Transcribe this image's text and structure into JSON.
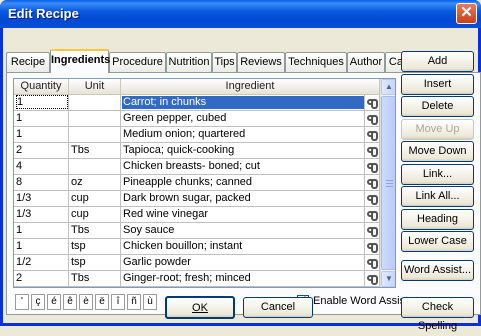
{
  "window": {
    "title": "Edit Recipe",
    "close_glyph": "✕"
  },
  "tabs": [
    "Recipe",
    "Ingredients",
    "Procedure",
    "Nutrition",
    "Tips",
    "Reviews",
    "Techniques",
    "Author",
    "Capture"
  ],
  "active_tab": "Ingredients",
  "grid": {
    "headers": [
      "Quantity",
      "Unit",
      "Ingredient"
    ],
    "rows": [
      {
        "quantity": "1",
        "unit": "",
        "ingredient": "Carrot; in chunks",
        "selected": true
      },
      {
        "quantity": "1",
        "unit": "",
        "ingredient": "Green pepper, cubed"
      },
      {
        "quantity": "1",
        "unit": "",
        "ingredient": "Medium onion; quartered"
      },
      {
        "quantity": "2",
        "unit": "Tbs",
        "ingredient": "Tapioca; quick-cooking"
      },
      {
        "quantity": "4",
        "unit": "",
        "ingredient": "Chicken breasts- boned; cut"
      },
      {
        "quantity": "8",
        "unit": "oz",
        "ingredient": "Pineapple chunks; canned"
      },
      {
        "quantity": "1/3",
        "unit": "cup",
        "ingredient": "Dark brown sugar, packed"
      },
      {
        "quantity": "1/3",
        "unit": "cup",
        "ingredient": "Red wine vinegar"
      },
      {
        "quantity": "1",
        "unit": "Tbs",
        "ingredient": "Soy sauce"
      },
      {
        "quantity": "1",
        "unit": "tsp",
        "ingredient": "Chicken bouillon; instant"
      },
      {
        "quantity": "1/2",
        "unit": "tsp",
        "ingredient": "Garlic powder"
      },
      {
        "quantity": "2",
        "unit": "Tbs",
        "ingredient": "Ginger-root; fresh; minced"
      }
    ],
    "link_icon": "chain-link-icon",
    "scroll_up": "▲",
    "scroll_down": "▼"
  },
  "side_buttons": [
    {
      "label": "Add",
      "enabled": true
    },
    {
      "label": "Insert",
      "enabled": true
    },
    {
      "label": "Delete",
      "enabled": true
    },
    {
      "label": "Move Up",
      "enabled": false
    },
    {
      "label": "Move Down",
      "enabled": true
    },
    {
      "label": "Link...",
      "enabled": true
    },
    {
      "label": "Link All...",
      "enabled": true
    },
    {
      "label": "Heading",
      "enabled": true
    },
    {
      "label": "Lower Case",
      "enabled": true
    }
  ],
  "accents": [
    "'",
    "ç",
    "é",
    "ê",
    "è",
    "ë",
    "î",
    "ñ",
    "ù"
  ],
  "word_assist": {
    "checkbox_label": "Enable Word Assist",
    "checked": true,
    "check_glyph": "✓",
    "button_label": "Word Assist..."
  },
  "footer": {
    "ok_label": "OK",
    "cancel_label": "Cancel",
    "spell_label": "Check Spelling"
  },
  "colors": {
    "selection": "#316ac5",
    "titlebar": "#0a59e0",
    "active_tab_accent": "#ffc83c"
  }
}
